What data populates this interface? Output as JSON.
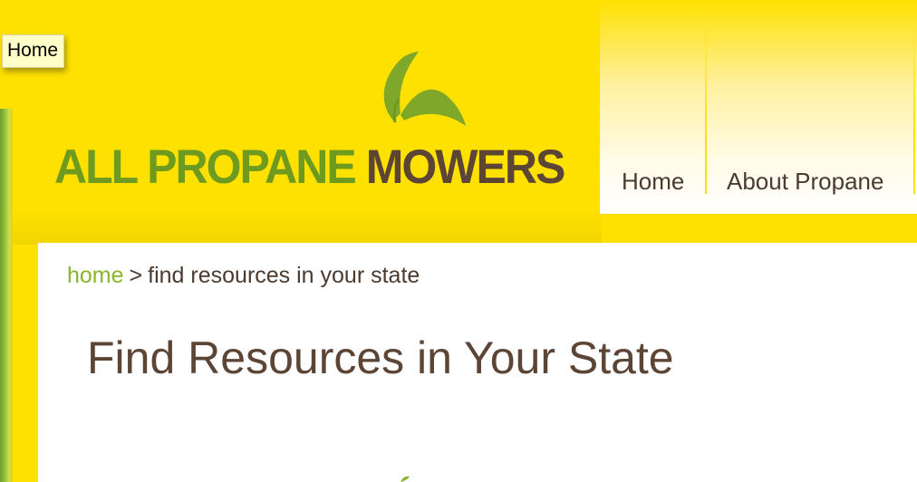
{
  "tooltip": {
    "text": "Home"
  },
  "logo": {
    "word1": "ALL PROPANE",
    "word2": "MOWERS"
  },
  "nav": {
    "items": [
      {
        "label": "Home"
      },
      {
        "label": "About Propane"
      }
    ]
  },
  "breadcrumb": {
    "home_label": "home",
    "separator": ">",
    "current": "find resources in your state"
  },
  "main": {
    "title": "Find Resources in Your State"
  },
  "colors": {
    "header_yellow": "#ffe100",
    "logo_green": "#6e9a1f",
    "logo_brown": "#5d4536",
    "link_green": "#8bb52b",
    "text_brown": "#4a3a2f"
  }
}
